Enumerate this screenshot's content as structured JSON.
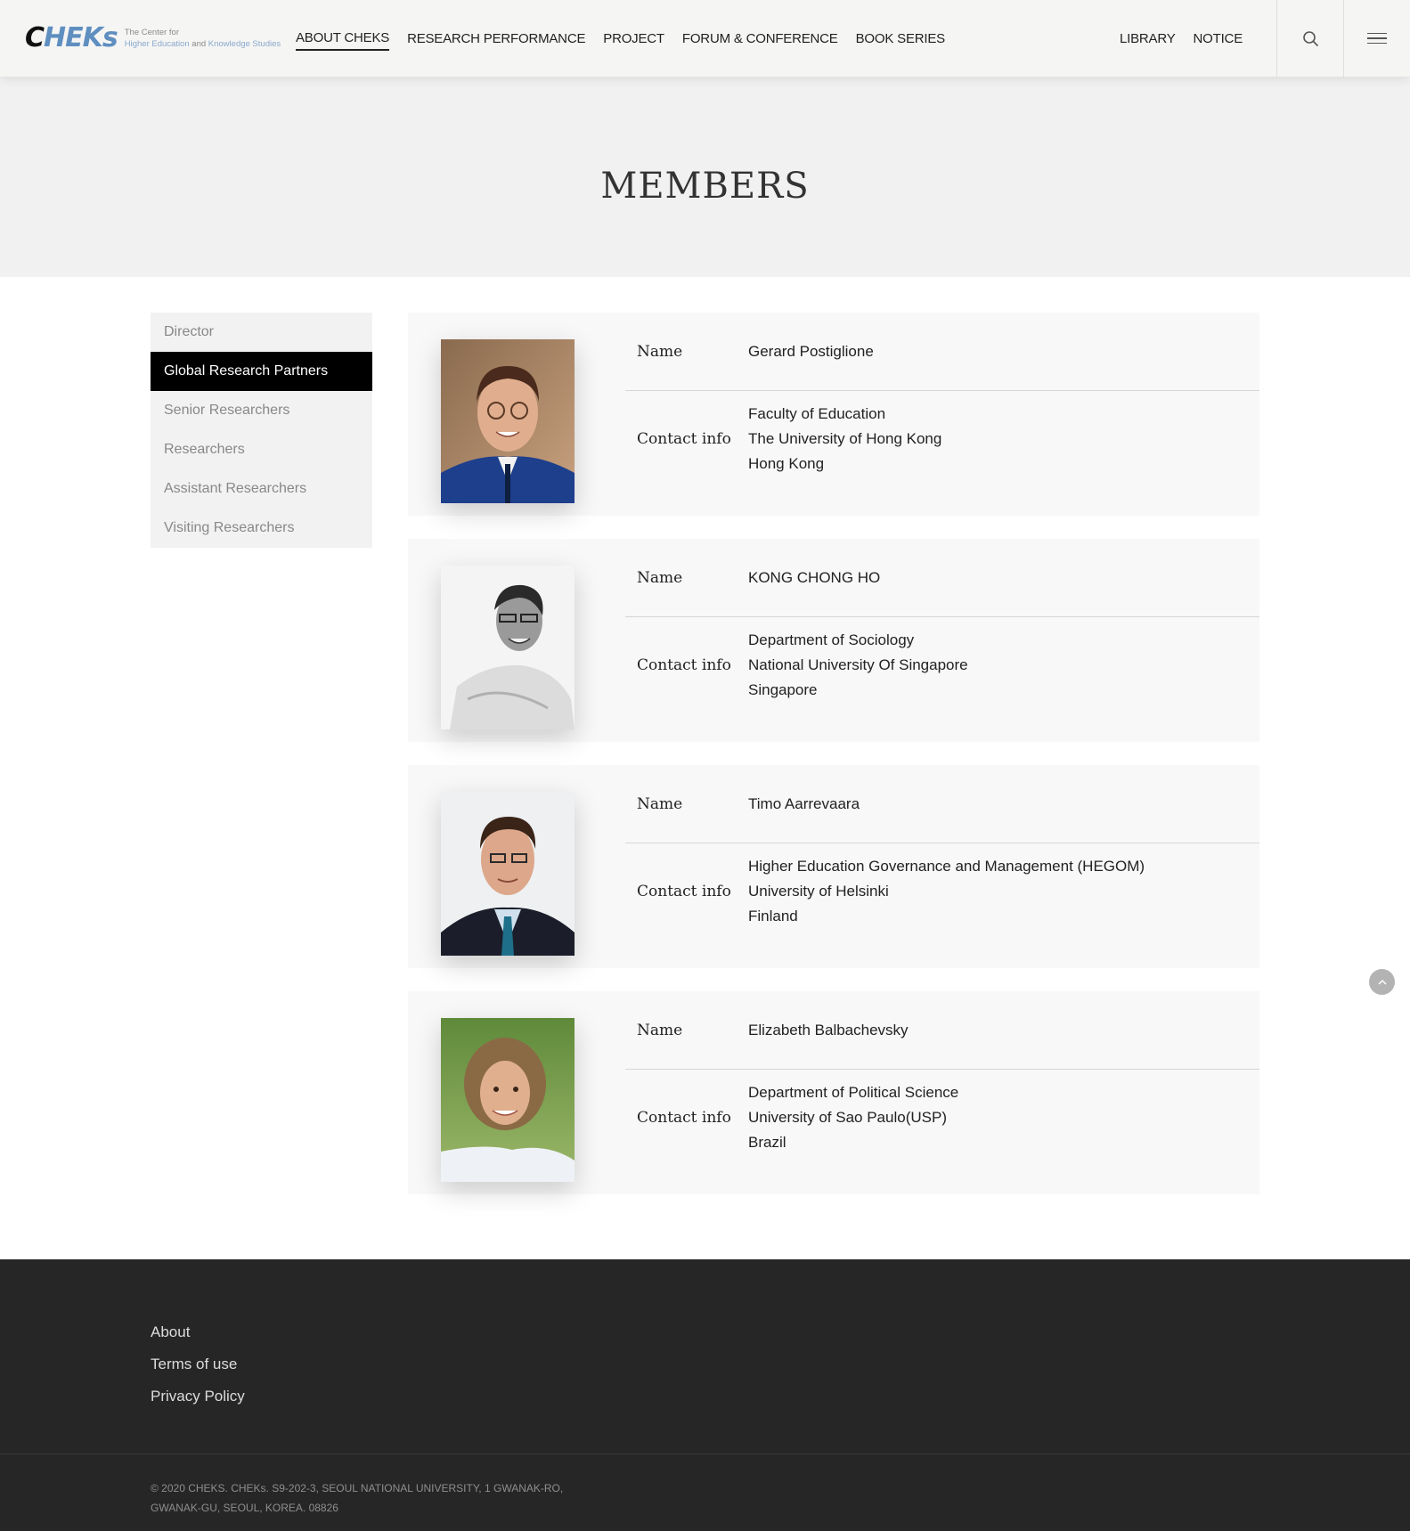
{
  "header": {
    "logo": {
      "mark_prefix": "C",
      "mark_rest": "HEKs",
      "line1": "The Center for",
      "line2_a": "Higher Education",
      "line2_b": "and",
      "line2_c": "Knowledge Studies"
    },
    "nav": [
      "ABOUT CHEKS",
      "RESEARCH PERFORMANCE",
      "PROJECT",
      "FORUM & CONFERENCE",
      "BOOK SERIES"
    ],
    "nav_active": "ABOUT CHEKS",
    "nav_right": [
      "LIBRARY",
      "NOTICE"
    ],
    "search_icon": "search-icon",
    "menu_icon": "hamburger-menu-icon"
  },
  "hero": {
    "title": "MEMBERS"
  },
  "sidebar": {
    "items": [
      {
        "label": "Director"
      },
      {
        "label": "Global Research Partners"
      },
      {
        "label": "Senior Researchers"
      },
      {
        "label": "Researchers"
      },
      {
        "label": "Assistant Researchers"
      },
      {
        "label": "Visiting Researchers"
      }
    ],
    "active": "Global Research Partners"
  },
  "labels": {
    "name": "Name",
    "contact": "Contact info"
  },
  "members": [
    {
      "name": "Gerard Postiglione",
      "contact": [
        "Faculty of Education",
        "The University of Hong Kong",
        "Hong Kong"
      ]
    },
    {
      "name": "KONG CHONG HO",
      "contact": [
        "Department of Sociology",
        "National University Of Singapore",
        "Singapore"
      ]
    },
    {
      "name": "Timo Aarrevaara",
      "contact": [
        "Higher Education Governance and Management (HEGOM)",
        "University of Helsinki",
        "Finland"
      ]
    },
    {
      "name": "Elizabeth Balbachevsky",
      "contact": [
        "Department of Political Science",
        "University of Sao Paulo(USP)",
        "Brazil"
      ]
    }
  ],
  "scroll_top_icon": "chevron-up-icon",
  "footer": {
    "links": [
      "About",
      "Terms of use",
      "Privacy Policy"
    ],
    "copyright": "© 2020 CHEKS. CHEKs. S9-202-3, SEOUL NATIONAL UNIVERSITY, 1 GWANAK-RO, GWANAK-GU, SEOUL, KOREA. 08826"
  },
  "colors": {
    "header_bg": "#f5f5f4",
    "hero_bg": "#f1f1f1",
    "sidebar_active_bg": "#000000",
    "card_bg": "#f8f8f8",
    "footer_bg": "#262626",
    "logo_accent": "#5f8fc0"
  }
}
